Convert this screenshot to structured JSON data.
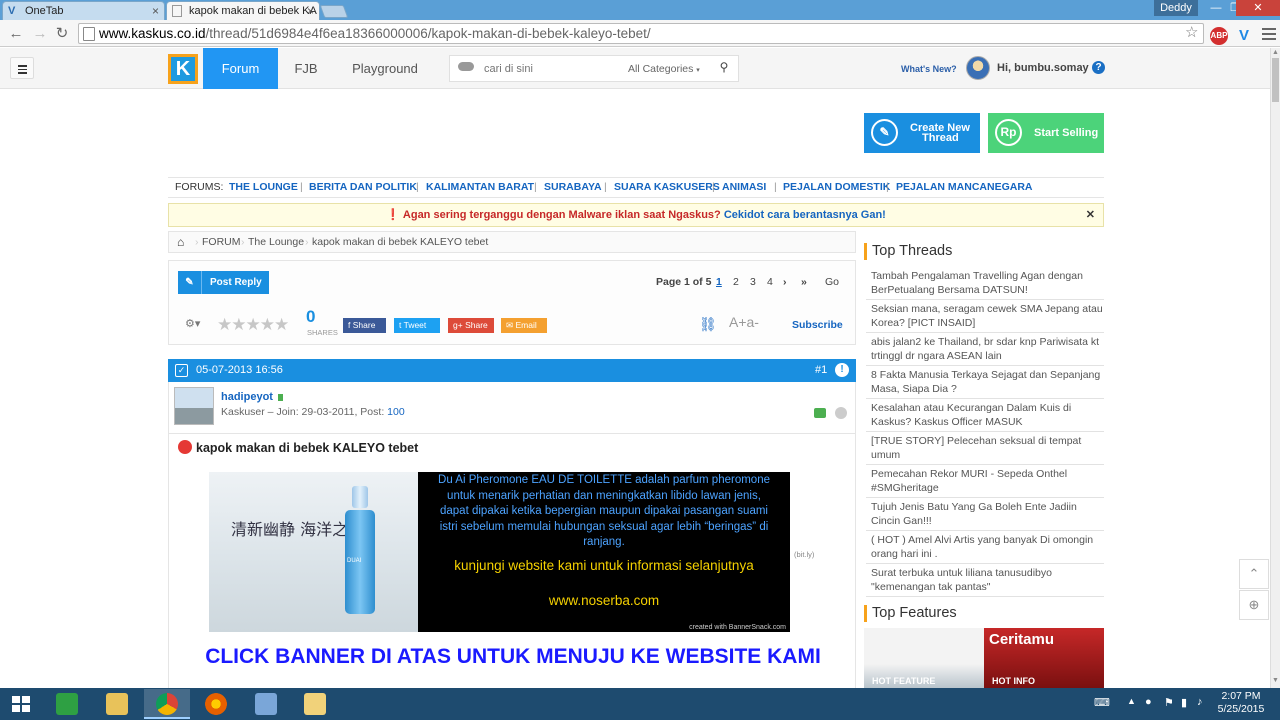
{
  "browser": {
    "tabs": [
      {
        "title": "OneTab",
        "active": false
      },
      {
        "title": "kapok makan di bebek KA",
        "active": true
      }
    ],
    "user_badge": "Deddy",
    "url_host": "www.kaskus.co.id",
    "url_path": "/thread/51d6984e4f6ea18366000006/kapok-makan-di-bebek-kaleyo-tebet/",
    "extensions": [
      "ABP",
      "V"
    ]
  },
  "header": {
    "nav": [
      "Forum",
      "FJB",
      "Playground"
    ],
    "search_placeholder": "cari di sini",
    "search_category": "All Categories",
    "whats_new": "What's New?",
    "greeting": "Hi, bumbu.somay"
  },
  "actions": {
    "create_thread_line1": "Create New",
    "create_thread_line2": "Thread",
    "start_selling": "Start Selling",
    "selling_icon": "Rp"
  },
  "forums": {
    "label": "FORUMS:",
    "links": [
      "THE LOUNGE",
      "BERITA DAN POLITIK",
      "KALIMANTAN BARAT",
      "SURABAYA",
      "SUARA KASKUSERS",
      "ANIMASI",
      "PEJALAN DOMESTIK",
      "PEJALAN MANCANEGARA"
    ]
  },
  "alert": {
    "warning": "Agan sering terganggu dengan Malware iklan saat Ngaskus?",
    "link": "Cekidot cara berantasnya Gan!"
  },
  "breadcrumb": [
    "FORUM",
    "The Lounge",
    "kapok makan di bebek KALEYO tebet"
  ],
  "toolbar": {
    "post_reply": "Post Reply",
    "page_info": "Page 1 of 5",
    "pages": [
      "1",
      "2",
      "3",
      "4"
    ],
    "go": "Go",
    "share_count": "0",
    "share_label": "SHARES",
    "share_buttons": [
      "Share",
      "Tweet",
      "Share",
      "Email"
    ],
    "subscribe": "Subscribe",
    "font_size": "A+a-"
  },
  "post": {
    "date": "05-07-2013 16:56",
    "number": "#1",
    "username": "hadipeyot",
    "meta_prefix": "Kaskuser – Join: 29-03-2011, Post: ",
    "post_count": "100",
    "title": "kapok makan di bebek KALEYO tebet",
    "banner_lines": [
      "Du Ai Pheromone EAU DE TOILETTE adalah parfum pheromone",
      "untuk menarik perhatian dan meningkatkan libido lawan jenis,",
      "dapat dipakai ketika bepergian maupun dipakai pasangan suami",
      "istri sebelum memulai hubungan seksual agar lebih “beringas” di",
      "ranjang."
    ],
    "banner_visit": "kunjungi website kami untuk informasi selanjutnya",
    "banner_site": "www.noserba.com",
    "banner_credit": "created with BannerSnack.com",
    "banner_chinese": "清新幽静 海洋之风",
    "banner_bottle_label": "DUAI",
    "bitly": "(bit.ly)",
    "click_text": "CLICK BANNER DI ATAS UNTUK MENUJU KE WEBSITE KAMI"
  },
  "sidebar": {
    "top_threads_title": "Top Threads",
    "threads": [
      "Tambah Pengalaman Travelling Agan dengan BerPetualang Bersama DATSUN!",
      "Seksian mana, seragam cewek SMA Jepang atau Korea? [PICT INSAID]",
      "abis jalan2 ke Thailand, br sdar knp Pariwisata kt trtinggl dr ngara ASEAN lain",
      "8 Fakta Manusia Terkaya Sejagat dan Sepanjang Masa, Siapa Dia ?",
      "Kesalahan atau Kecurangan Dalam Kuis di Kaskus? Kaskus Officer MASUK",
      "[TRUE STORY] Pelecehan seksual di tempat umum",
      "Pemecahan Rekor MURI - Sepeda Onthel #SMGheritage",
      "Tujuh Jenis Batu Yang Ga Boleh Ente Jadiin Cincin Gan!!!",
      "( HOT ) Amel Alvi Artis yang banyak Di omongin orang hari ini .",
      "Surat terbuka untuk liliana tanusudibyo \"kemenangan tak pantas\""
    ],
    "top_features_title": "Top Features",
    "features": [
      "HOT FEATURE",
      "HOT INFO"
    ],
    "feature_brand": "Ceritamu"
  },
  "taskbar": {
    "time": "2:07 PM",
    "date": "5/25/2015"
  },
  "colors": {
    "kaskus_blue": "#2196f3",
    "create_button": "#1a8fe0",
    "selling_button": "#4cd37a",
    "logo_orange": "#f7a21b"
  }
}
